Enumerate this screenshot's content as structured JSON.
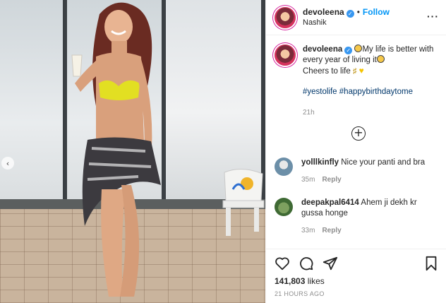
{
  "post": {
    "username": "devoleena",
    "follow_label": "Follow",
    "location": "Nashik",
    "caption_text_1": "My life is better with every year of living it",
    "caption_text_2": "Cheers to life",
    "hashtags": "#yestolife #happybirthdaytome",
    "caption_time": "21h"
  },
  "comments": [
    {
      "username": "yolllkinfly",
      "text": "Nice your panti and bra",
      "time": "35m",
      "reply_label": "Reply"
    },
    {
      "username": "deepakpal6414",
      "text": "Ahem ji dekh kr gussa honge",
      "time": "33m",
      "reply_label": "Reply"
    }
  ],
  "footer": {
    "likes_count": "141,803",
    "likes_label": "likes",
    "posted_ago": "21 HOURS AGO"
  },
  "colors": {
    "link_blue": "#0095f6",
    "hashtag_blue": "#00376b",
    "muted_gray": "#8e8e8e",
    "verified_blue": "#3897f0"
  }
}
